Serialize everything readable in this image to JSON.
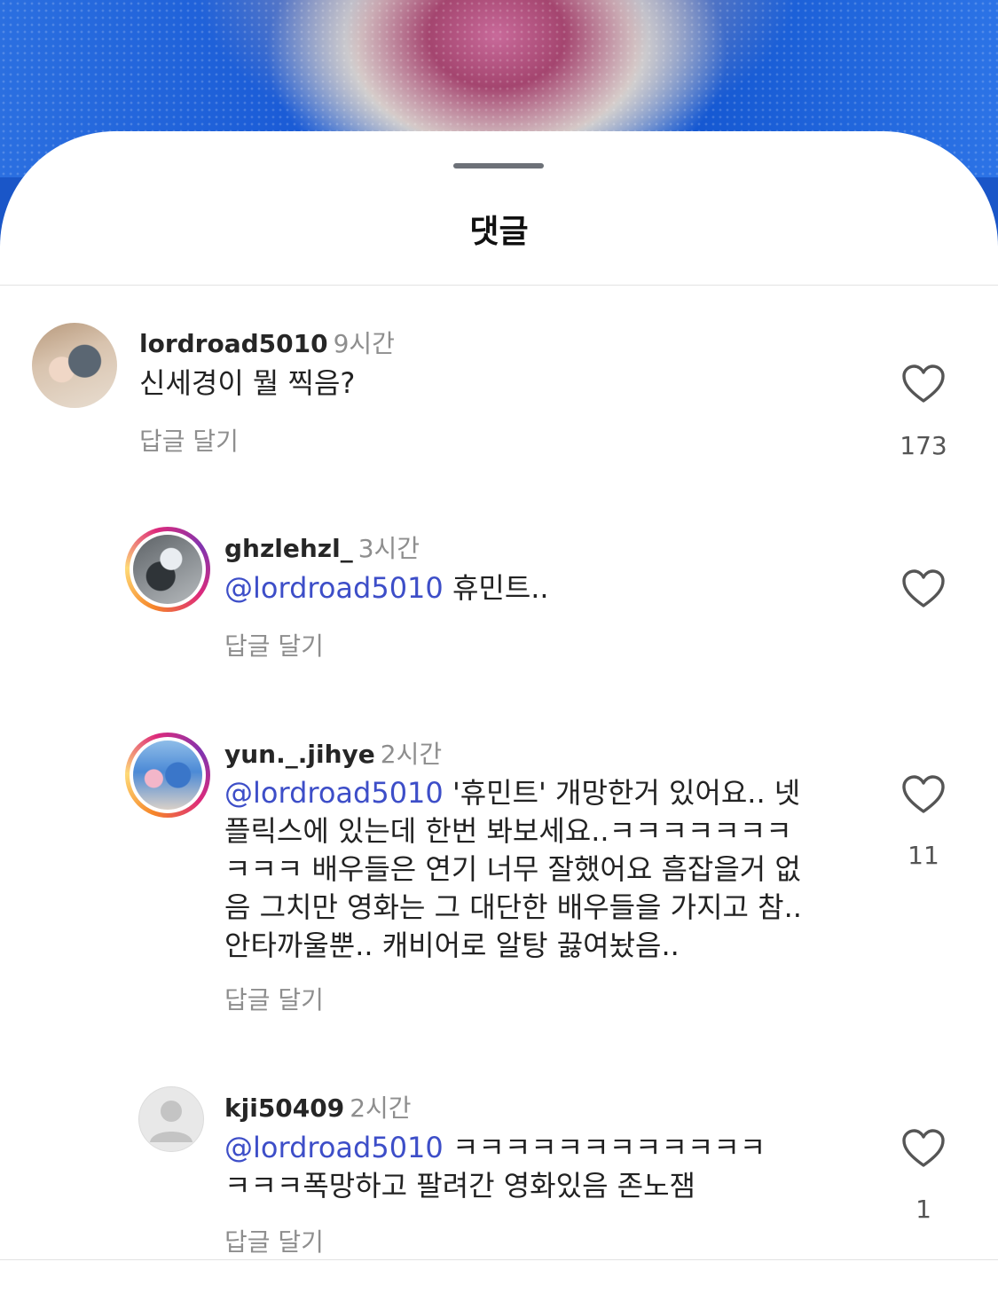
{
  "sheet": {
    "title": "댓글"
  },
  "comments": [
    {
      "username": "lordroad5010",
      "time": "9시간",
      "text": "신세경이 뭘 찍음?",
      "reply": "답글 달기",
      "likes": "173"
    },
    {
      "username": "ghzlehzl_",
      "time": "3시간",
      "mention": "@lordroad5010",
      "text": " 휴민트..",
      "reply": "답글 달기",
      "likes": ""
    },
    {
      "username": "yun._.jihye",
      "time": "2시간",
      "mention": "@lordroad5010",
      "lines": [
        " '휴민트' 개망한거 있어요.. 넷",
        "플릭스에 있는데 한번 봐보세요..ㅋㅋㅋㅋㅋㅋㅋ",
        "ㅋㅋㅋ 배우들은 연기 너무 잘했어요 흠잡을거 없",
        "음 그치만 영화는 그 대단한 배우들을 가지고 참..",
        "안타까울뿐.. 캐비어로 알탕 끓여놨음.."
      ],
      "reply": "답글 달기",
      "likes": "11"
    },
    {
      "username": "kji50409",
      "time": "2시간",
      "mention": "@lordroad5010",
      "lines": [
        " ㅋㅋㅋㅋㅋㅋㅋㅋㅋㅋㅋㅋ",
        "ㅋㅋㅋ폭망하고 팔려간 영화있음 존노잼"
      ],
      "reply": "답글 달기",
      "likes": "1"
    }
  ]
}
